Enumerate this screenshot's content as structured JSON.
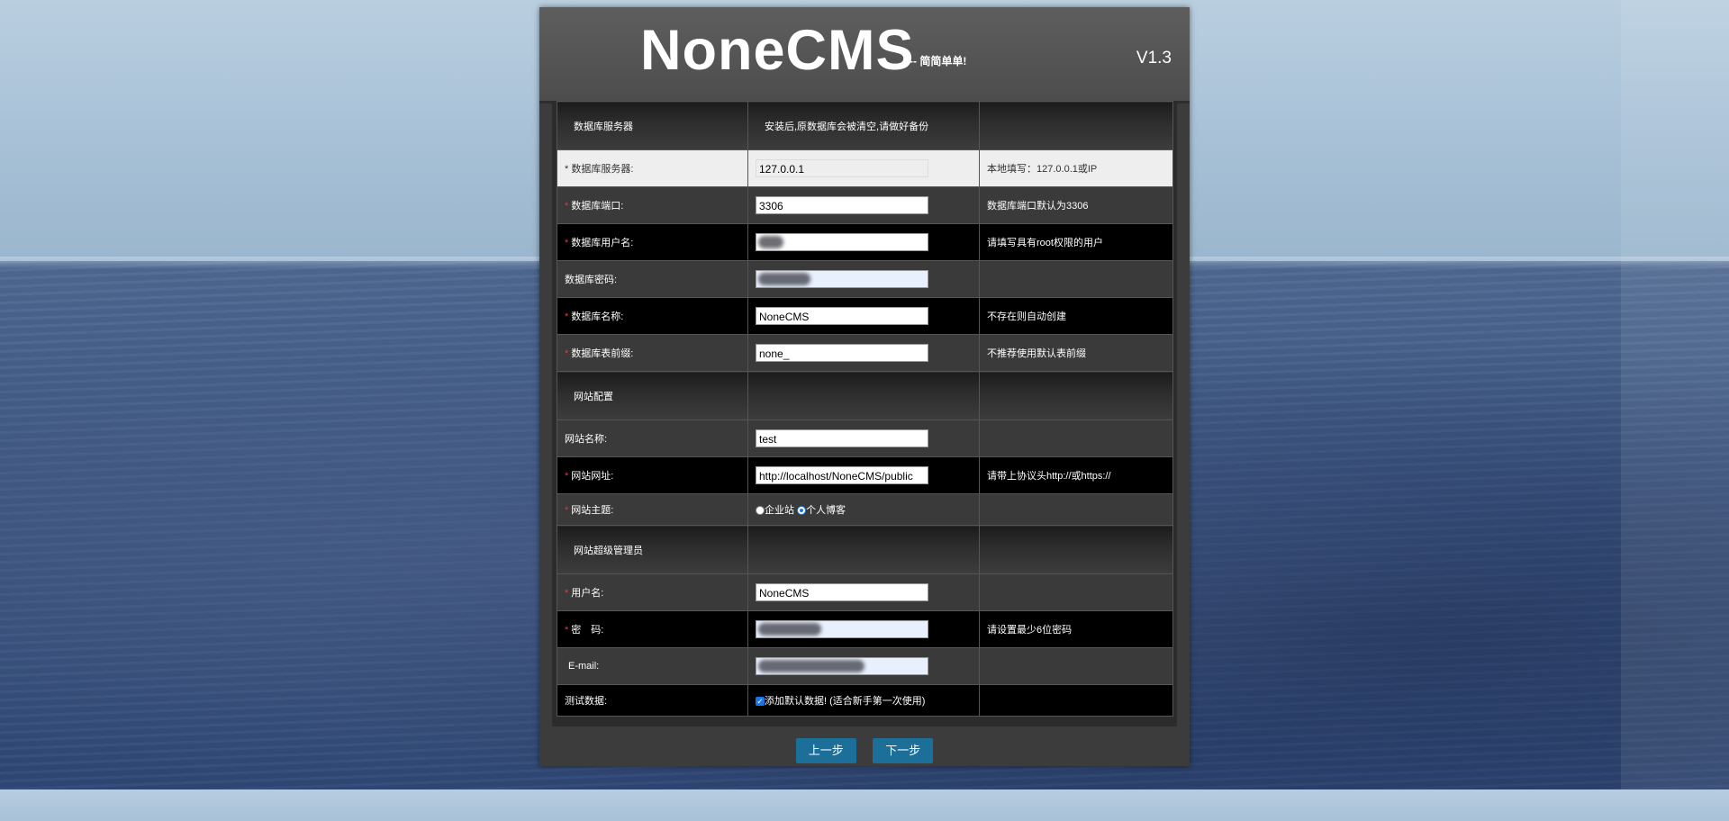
{
  "brand": {
    "title": "NoneCMS",
    "slogan": "-- 简简单单!",
    "version": "V1.3"
  },
  "sections": {
    "db": {
      "label": "数据库服务器",
      "note": "安装后,原数据库会被清空,请做好备份"
    },
    "site": {
      "label": "网站配置"
    },
    "admin": {
      "label": "网站超级管理员"
    }
  },
  "fields": {
    "db_host": {
      "label": "* 数据库服务器:",
      "value": "127.0.0.1",
      "hint": "本地填写：127.0.0.1或IP"
    },
    "db_port": {
      "label": "数据库端口:",
      "value": "3306",
      "hint": "数据库端口默认为3306"
    },
    "db_user": {
      "label": "数据库用户名:",
      "value": "",
      "hint": "请填写具有root权限的用户"
    },
    "db_pass": {
      "label": "数据库密码:",
      "value": "",
      "hint": ""
    },
    "db_name": {
      "label": "数据库名称:",
      "value": "NoneCMS",
      "hint": "不存在则自动创建"
    },
    "db_prefix": {
      "label": "数据库表前缀:",
      "value": "none_",
      "hint": "不推荐使用默认表前缀"
    },
    "site_name": {
      "label": "网站名称:",
      "value": "test",
      "hint": ""
    },
    "site_url": {
      "label": "网站网址:",
      "value": "http://localhost/NoneCMS/public",
      "hint": "请带上协议头http://或https://"
    },
    "site_theme": {
      "label": "网站主题:",
      "options": [
        "企业站",
        "个人博客"
      ],
      "selected": "个人博客"
    },
    "admin_user": {
      "label": "用户名:",
      "value": "NoneCMS",
      "hint": ""
    },
    "admin_pass": {
      "label": "密　码:",
      "value": "",
      "hint": "请设置最少6位密码"
    },
    "admin_email": {
      "label": "E-mail:",
      "value": "",
      "hint": ""
    },
    "test_data": {
      "label": "测试数据:",
      "checkbox_label": "添加默认数据! (适合新手第一次使用)",
      "checked": true
    }
  },
  "buttons": {
    "prev": "上一步",
    "next": "下一步"
  },
  "colors": {
    "button": "#1b6f99",
    "required": "#e23b3b",
    "panel": "#3c3c3c"
  }
}
